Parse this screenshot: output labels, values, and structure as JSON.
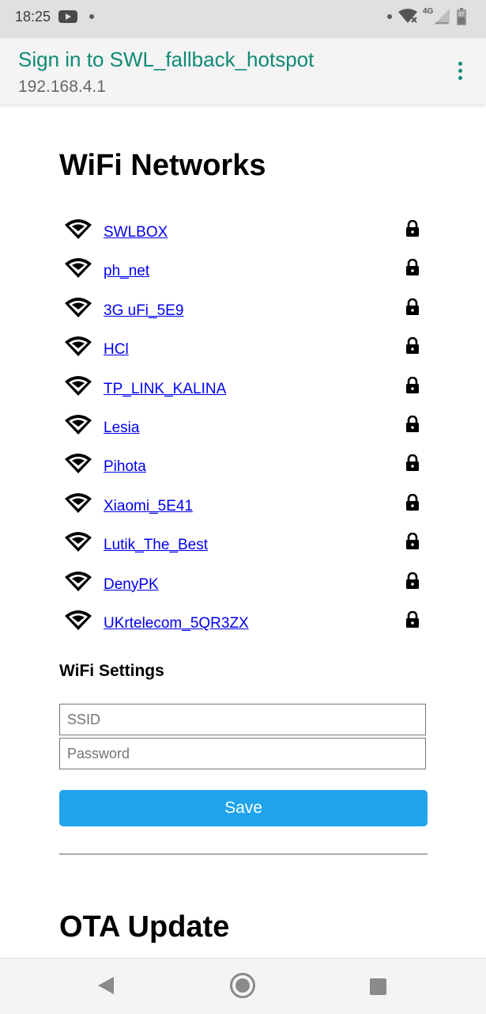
{
  "status_bar": {
    "time": "18:25",
    "network_type": "4G",
    "battery_level": "37",
    "icons": [
      "youtube-icon",
      "notification-dot-icon",
      "wifi-icon",
      "signal-icon",
      "battery-icon"
    ]
  },
  "app_bar": {
    "title": "Sign in to SWL_fallback_hotspot",
    "subtitle": "192.168.4.1",
    "accent_color": "#0f8a76"
  },
  "wifi_section": {
    "title": "WiFi Networks",
    "networks": [
      {
        "ssid": "SWLBOX",
        "locked": true
      },
      {
        "ssid": "ph_net",
        "locked": true
      },
      {
        "ssid": "3G uFi_5E9",
        "locked": true
      },
      {
        "ssid": "HCl",
        "locked": true
      },
      {
        "ssid": "TP_LINK_KALINA",
        "locked": true
      },
      {
        "ssid": "Lesia",
        "locked": true
      },
      {
        "ssid": "Pihota",
        "locked": true
      },
      {
        "ssid": "Xiaomi_5E41",
        "locked": true
      },
      {
        "ssid": "Lutik_The_Best",
        "locked": true
      },
      {
        "ssid": "DenyPK",
        "locked": true
      },
      {
        "ssid": "UKrtelecom_5QR3ZX",
        "locked": true
      }
    ]
  },
  "settings": {
    "title": "WiFi Settings",
    "ssid_placeholder": "SSID",
    "password_placeholder": "Password",
    "save_label": "Save",
    "button_color": "#1fa3ec"
  },
  "ota": {
    "title": "OTA Update"
  },
  "nav_bar": {
    "icons": [
      "back-icon",
      "home-icon",
      "recents-icon"
    ]
  }
}
